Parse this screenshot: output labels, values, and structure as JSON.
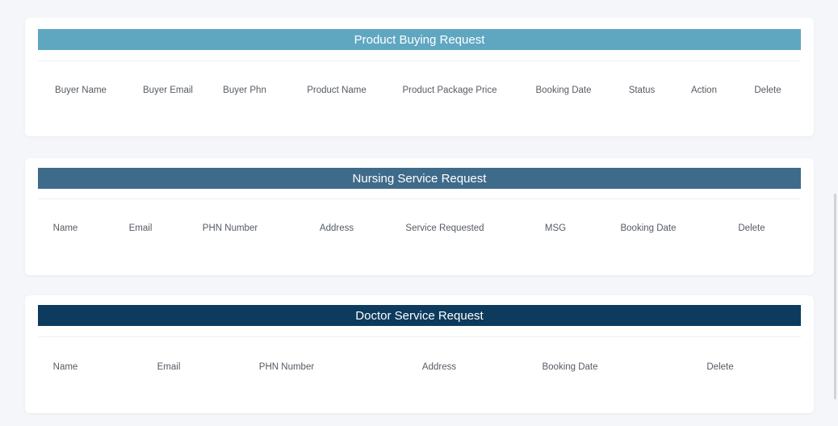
{
  "sections": {
    "product": {
      "title": "Product Buying Request",
      "color": "#5fa7c1",
      "headers": [
        "Buyer Name",
        "Buyer Email",
        "Buyer Phn",
        "Product Name",
        "Product Package Price",
        "Booking Date",
        "Status",
        "Action",
        "Delete"
      ]
    },
    "nursing": {
      "title": "Nursing Service Request",
      "color": "#3f6b8a",
      "headers": [
        "Name",
        "Email",
        "PHN Number",
        "Address",
        "Service Requested",
        "MSG",
        "Booking Date",
        "Delete"
      ]
    },
    "doctor": {
      "title": "Doctor Service Request",
      "color": "#0c3b5e",
      "headers": [
        "Name",
        "Email",
        "PHN Number",
        "Address",
        "Booking Date",
        "Delete"
      ]
    }
  }
}
